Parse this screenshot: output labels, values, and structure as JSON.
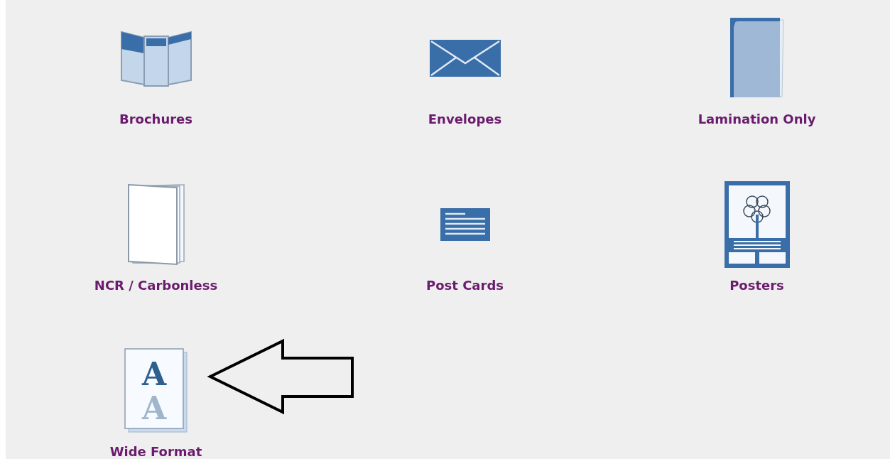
{
  "categories": [
    {
      "label": "Brochures",
      "kind": "brochure"
    },
    {
      "label": "Envelopes",
      "kind": "envelope"
    },
    {
      "label": "Lamination Only",
      "kind": "lamination"
    },
    {
      "label": "NCR / Carbonless",
      "kind": "booklet"
    },
    {
      "label": "Post Cards",
      "kind": "postcard"
    },
    {
      "label": "Posters",
      "kind": "poster"
    },
    {
      "label": "Wide Format",
      "kind": "letters",
      "letters": [
        "A",
        "A"
      ]
    }
  ]
}
